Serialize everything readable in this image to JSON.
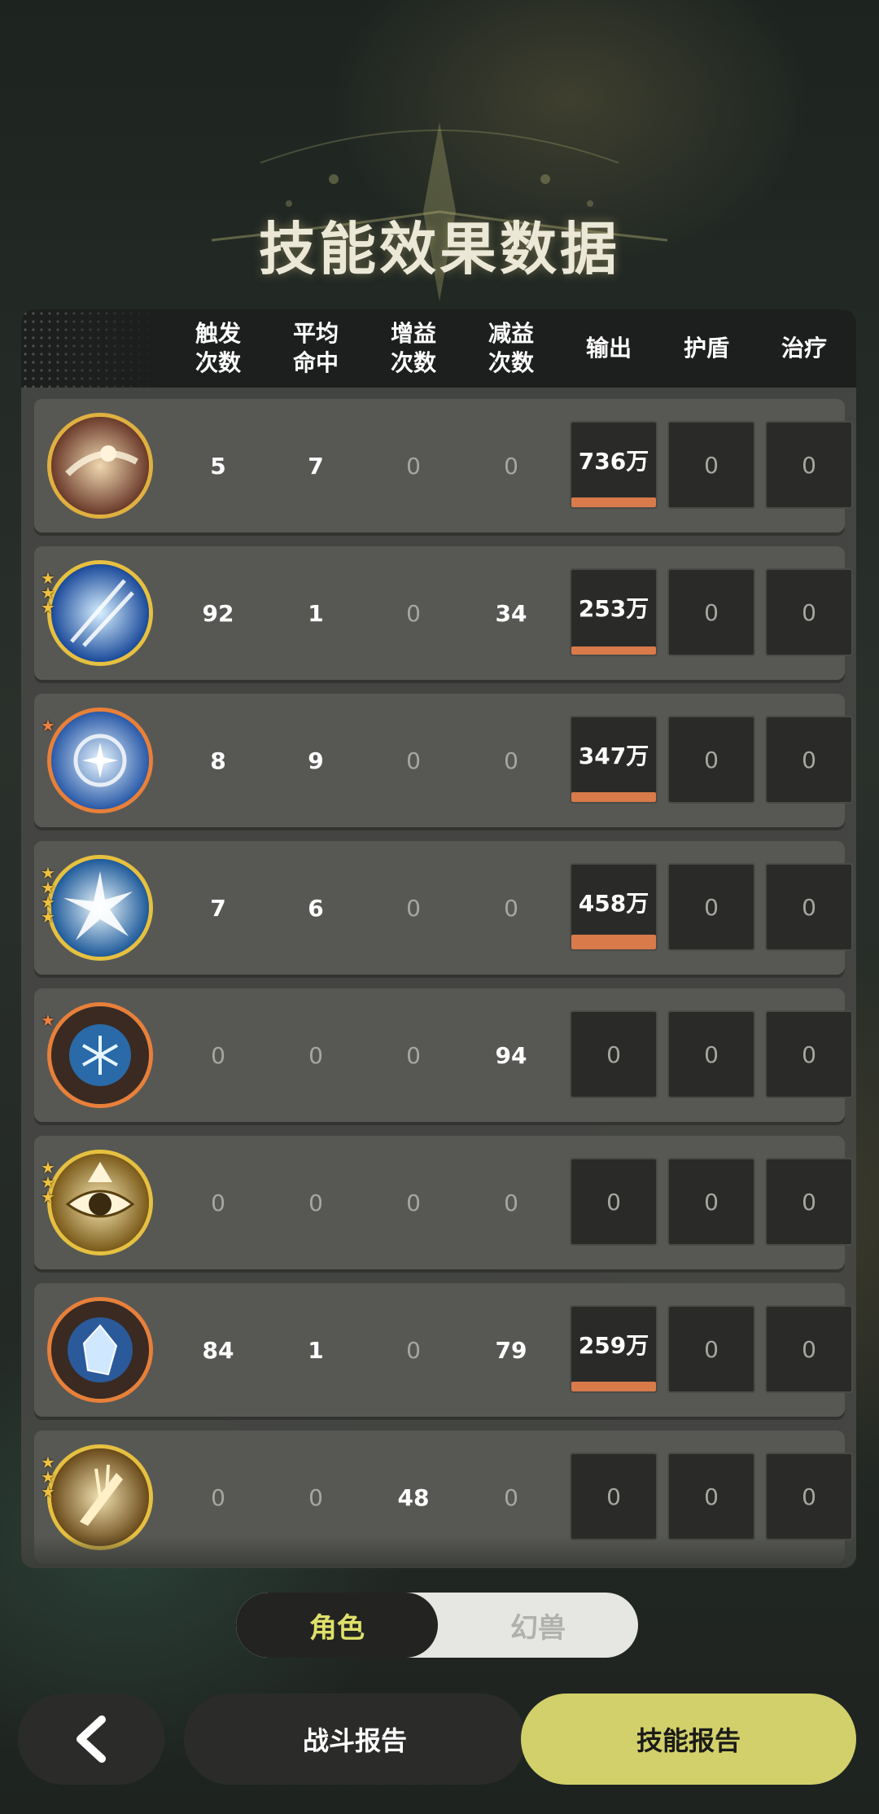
{
  "title": "技能效果数据",
  "header": {
    "columns": [
      "触发\n次数",
      "平均\n命中",
      "增益\n次数",
      "减益\n次数",
      "输出",
      "护盾",
      "治疗"
    ]
  },
  "rows": [
    {
      "icon": "dash-kick-skill-icon",
      "ring": "#e0456a",
      "stars": 0,
      "trigger": "5",
      "avg_hit": "7",
      "buff": "0",
      "debuff": "0",
      "output": "736万",
      "output_bar": 1.0,
      "shield": "0",
      "heal": "0"
    },
    {
      "icon": "ice-slash-skill-icon",
      "ring": "#e6c040",
      "stars": 3,
      "trigger": "92",
      "avg_hit": "1",
      "buff": "0",
      "debuff": "34",
      "output": "253万",
      "output_bar": 0.34,
      "shield": "0",
      "heal": "0"
    },
    {
      "icon": "frost-vortex-skill-icon",
      "ring": "#e8803a",
      "stars": 1,
      "trigger": "8",
      "avg_hit": "9",
      "buff": "0",
      "debuff": "0",
      "output": "347万",
      "output_bar": 0.47,
      "shield": "0",
      "heal": "0"
    },
    {
      "icon": "ice-shatter-skill-icon",
      "ring": "#e6c040",
      "stars": 4,
      "trigger": "7",
      "avg_hit": "6",
      "buff": "0",
      "debuff": "0",
      "output": "458万",
      "output_bar": 0.62,
      "shield": "0",
      "heal": "0"
    },
    {
      "icon": "snowflake-skill-icon",
      "ring": "#e8803a",
      "stars": 1,
      "trigger": "0",
      "avg_hit": "0",
      "buff": "0",
      "debuff": "94",
      "output": "0",
      "output_bar": 0,
      "shield": "0",
      "heal": "0"
    },
    {
      "icon": "eye-skill-icon",
      "ring": "#e6c040",
      "stars": 3,
      "trigger": "0",
      "avg_hit": "0",
      "buff": "0",
      "debuff": "0",
      "output": "0",
      "output_bar": 0,
      "shield": "0",
      "heal": "0"
    },
    {
      "icon": "ice-crystal-skill-icon",
      "ring": "#e8803a",
      "stars": 0,
      "trigger": "84",
      "avg_hit": "1",
      "buff": "0",
      "debuff": "79",
      "output": "259万",
      "output_bar": 0.35,
      "shield": "0",
      "heal": "0"
    },
    {
      "icon": "golden-blade-skill-icon",
      "ring": "#e6c040",
      "stars": 3,
      "trigger": "0",
      "avg_hit": "0",
      "buff": "48",
      "debuff": "0",
      "output": "0",
      "output_bar": 0,
      "shield": "0",
      "heal": "0"
    }
  ],
  "toggle": {
    "active": "角色",
    "inactive": "幻兽"
  },
  "buttons": {
    "back_icon": "chevron-left-icon",
    "battle_report": "战斗报告",
    "skill_report": "技能报告"
  },
  "colors": {
    "accent": "#d2d06a",
    "output_bar": "#d87a4a"
  }
}
